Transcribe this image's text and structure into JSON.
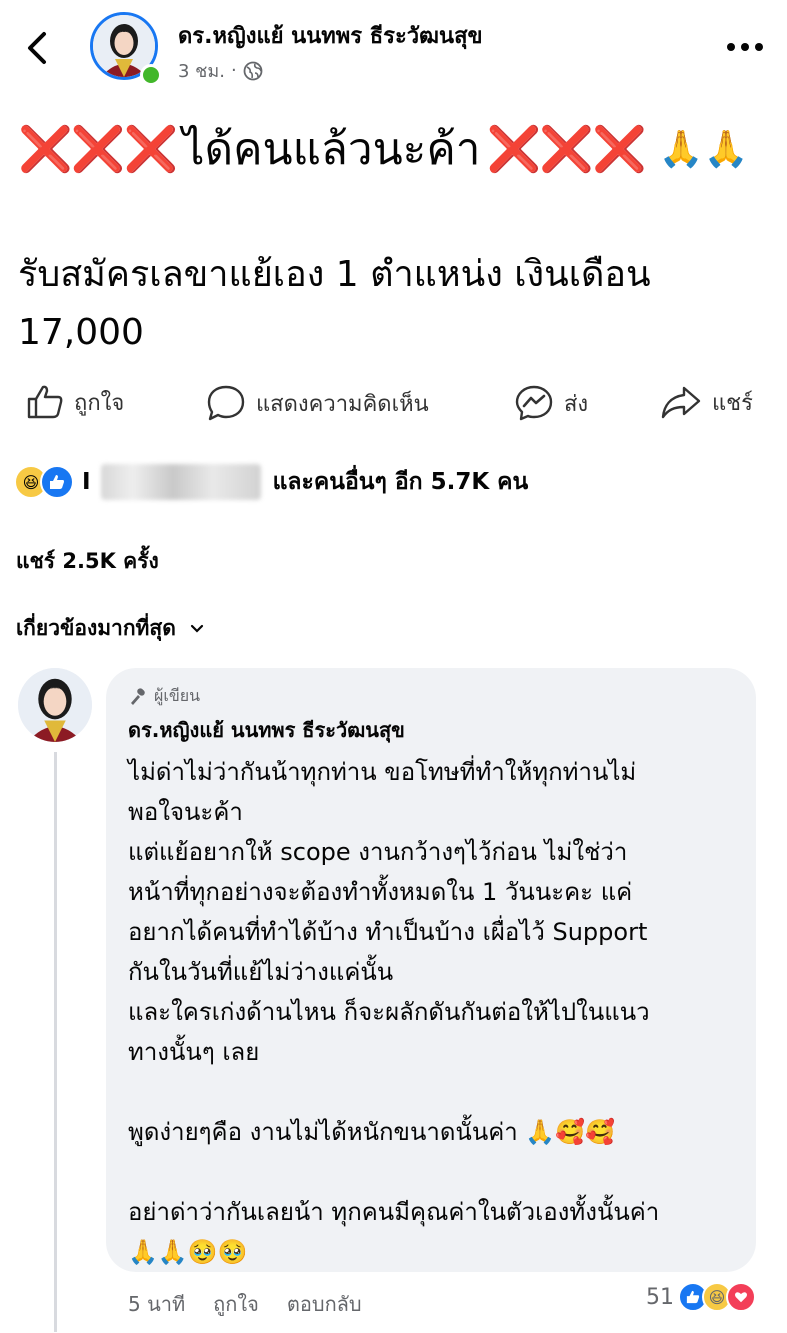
{
  "header": {
    "author_name": "ดร.หญิงแย้ นนทพร ธีระวัฒนสุข",
    "time": "3 ชม.",
    "separator": "·",
    "privacy_icon": "globe-icon",
    "more_icon": "more-dots-icon"
  },
  "post": {
    "headline_x_left": "❌❌❌",
    "headline_text": "ได้คนแล้วนะค้า",
    "headline_x_right": "❌❌❌",
    "headline_emoji": "🙏🙏",
    "body_line1": "รับสมัครเลขาแย้เอง 1 ตำแหน่ง เงินเดือน",
    "body_line2": "17,000"
  },
  "actions": {
    "like": "ถูกใจ",
    "comment": "แสดงความคิดเห็น",
    "send": "ส่ง",
    "share": "แชร์"
  },
  "reactions": {
    "name_initial": "I",
    "others_text": "และคนอื่นๆ อีก 5.7K คน",
    "icons": [
      "haha-icon",
      "like-icon"
    ]
  },
  "share_count": "แชร์ 2.5K ครั้ง",
  "sort": {
    "label": "เกี่ยวข้องมากที่สุด",
    "icon": "chevron-down-icon"
  },
  "comment": {
    "badge": "ผู้เขียน",
    "author": "ดร.หญิงแย้ นนทพร ธีระวัฒนสุข",
    "lines": [
      "ไม่ด่าไม่ว่ากันน้าทุกท่าน ขอโทษที่ทำให้ทุกท่านไม่",
      "พอใจนะค้า",
      "แต่แย้อยากให้ scope งานกว้างๆไว้ก่อน ไม่ใช่ว่า",
      "หน้าที่ทุกอย่างจะต้องทำทั้งหมดใน 1 วันนะคะ แค่",
      "อยากได้คนที่ทำได้บ้าง ทำเป็นบ้าง เผื่อไว้ Support",
      "กันในวันที่แย้ไม่ว่างแค่นั้น",
      "และใครเก่งด้านไหน ก็จะผลักดันกันต่อให้ไปในแนว",
      "ทางนั้นๆ เลย"
    ],
    "line_simple": "พูดง่ายๆคือ งานไม่ได้หนักขนาดนั้นค่า 🙏🥰🥰",
    "line_closing": "อย่าด่าว่ากันเลยน้า ทุกคนมีคุณค่าในตัวเองทั้งนั้นค่า",
    "closing_emoji": "🙏🙏🥹🥹",
    "time": "5 นาที",
    "like": "ถูกใจ",
    "reply": "ตอบกลับ",
    "reaction_count": "51"
  }
}
